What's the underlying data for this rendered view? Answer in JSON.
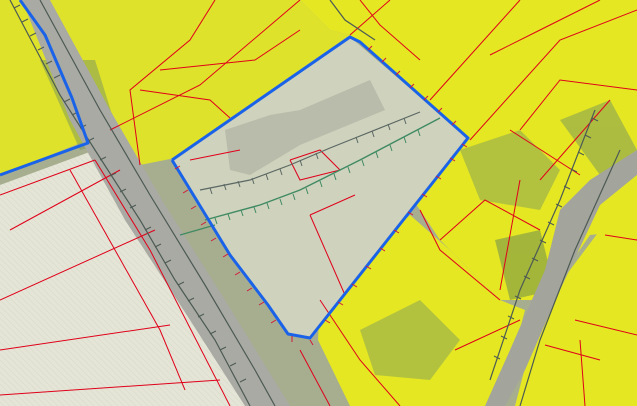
{
  "map": {
    "type": "cadastral-zoning-overlay",
    "basemap": "aerial-imagery",
    "colors": {
      "zone_yellow": "#e9ec1c",
      "zone_gray": "#e2e2d4",
      "selected_area": "#cfd2bd",
      "parcel_line": "#e0001a",
      "selection_outline": "#1a63e8",
      "road": "#a9aaa3",
      "hatch_line": "#4c5a54",
      "green_hatch": "#3f8a63"
    },
    "layers": [
      "parcel-boundaries",
      "zoning-yellow",
      "zoning-gray",
      "selected-parcel",
      "hatched-boundaries"
    ]
  }
}
